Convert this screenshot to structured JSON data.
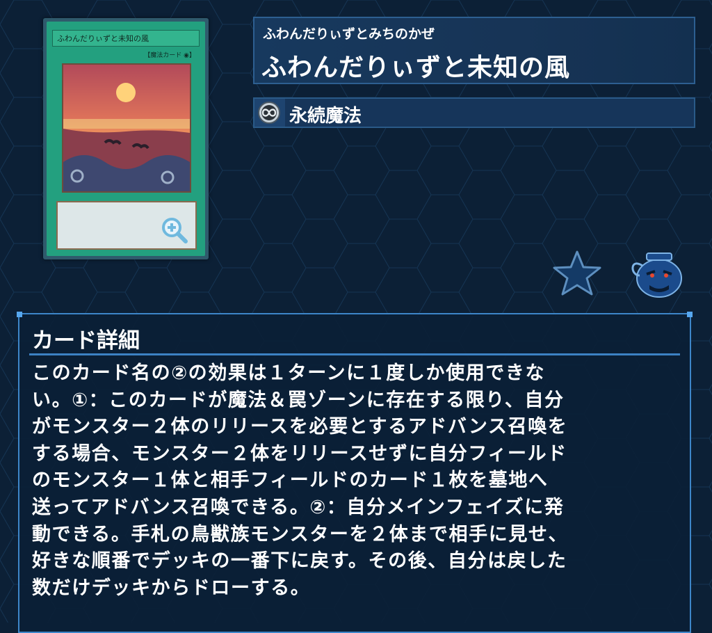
{
  "card": {
    "name_on_card": "ふわんだりぃずと未知の風",
    "attribute_on_card": "魔",
    "type_on_card": "【魔法カード 📎】"
  },
  "header": {
    "ruby": "ふわんだりぃずとみちのかぜ",
    "title": "ふわんだりぃずと未知の風"
  },
  "type": {
    "label": "永続魔法",
    "icon": "continuous-infinity-icon"
  },
  "actions": {
    "favorite_icon": "star-icon",
    "deck_icon": "pot-of-greed-icon",
    "zoom_icon": "zoom-in-icon"
  },
  "detail": {
    "heading": "カード詳細",
    "lines": [
      "このカード名の②の効果は１ターンに１度しか使用できな",
      "い。①：このカードが魔法＆罠ゾーンに存在する限り、自分",
      "がモンスター２体のリリースを必要とするアドバンス召喚を",
      "する場合、モンスター２体をリリースせずに自分フィールド",
      "のモンスター１体と相手フィールドのカード１枚を墓地へ",
      "送ってアドバンス召喚できる。②：自分メインフェイズに発",
      "動できる。手札の鳥獣族モンスターを２体まで相手に見せ、",
      "好きな順番でデッキの一番下に戻す。その後、自分は戻した",
      "数だけデッキからドローする。"
    ]
  },
  "colors": {
    "background": "#0c2036",
    "panel_border": "#3d86c9",
    "title_bg": "#17395e",
    "card_frame": "#23a07f"
  }
}
